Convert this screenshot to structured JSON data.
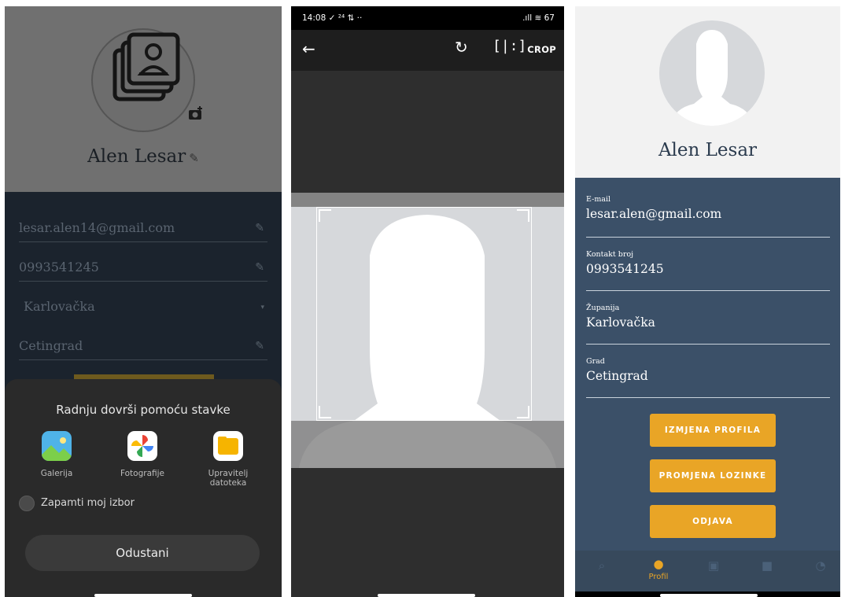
{
  "panel1": {
    "name": "Alen Lesar",
    "fields": [
      {
        "value": "lesar.alen14@gmail.com"
      },
      {
        "value": "0993541245"
      },
      {
        "value": "Karlovačka"
      },
      {
        "value": "Cetingrad"
      }
    ],
    "sheet": {
      "title": "Radnju dovrši pomoću stavke",
      "apps": [
        {
          "label": "Galerija",
          "icon": "gallery-icon"
        },
        {
          "label": "Fotografije",
          "icon": "photos-icon"
        },
        {
          "label": "Upravitelj datoteka",
          "icon": "file-manager-icon"
        }
      ],
      "remember": "Zapamti moj izbor",
      "cancel": "Odustani"
    }
  },
  "panel2": {
    "status_time": "14:08",
    "status_right": ".ıll ≋ 67",
    "crop_label": "CROP"
  },
  "panel3": {
    "name": "Alen Lesar",
    "fields": [
      {
        "label": "E-mail",
        "value": "lesar.alen@gmail.com"
      },
      {
        "label": "Kontakt broj",
        "value": "0993541245"
      },
      {
        "label": "Županija",
        "value": "Karlovačka"
      },
      {
        "label": "Grad",
        "value": "Cetingrad"
      }
    ],
    "buttons": {
      "edit": "IZMJENA PROFILA",
      "password": "PROMJENA LOZINKE",
      "logout": "ODJAVA"
    },
    "nav_active_label": "Profil",
    "accent": "#e9a526"
  }
}
